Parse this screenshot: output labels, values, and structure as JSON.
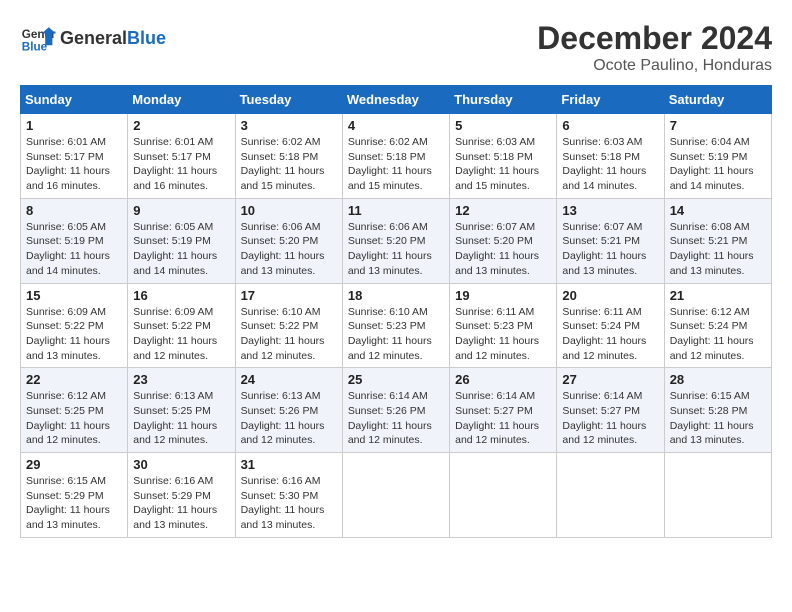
{
  "logo": {
    "text_general": "General",
    "text_blue": "Blue"
  },
  "title": "December 2024",
  "subtitle": "Ocote Paulino, Honduras",
  "days_of_week": [
    "Sunday",
    "Monday",
    "Tuesday",
    "Wednesday",
    "Thursday",
    "Friday",
    "Saturday"
  ],
  "weeks": [
    [
      {
        "day": "1",
        "info": "Sunrise: 6:01 AM\nSunset: 5:17 PM\nDaylight: 11 hours and 16 minutes."
      },
      {
        "day": "2",
        "info": "Sunrise: 6:01 AM\nSunset: 5:17 PM\nDaylight: 11 hours and 16 minutes."
      },
      {
        "day": "3",
        "info": "Sunrise: 6:02 AM\nSunset: 5:18 PM\nDaylight: 11 hours and 15 minutes."
      },
      {
        "day": "4",
        "info": "Sunrise: 6:02 AM\nSunset: 5:18 PM\nDaylight: 11 hours and 15 minutes."
      },
      {
        "day": "5",
        "info": "Sunrise: 6:03 AM\nSunset: 5:18 PM\nDaylight: 11 hours and 15 minutes."
      },
      {
        "day": "6",
        "info": "Sunrise: 6:03 AM\nSunset: 5:18 PM\nDaylight: 11 hours and 14 minutes."
      },
      {
        "day": "7",
        "info": "Sunrise: 6:04 AM\nSunset: 5:19 PM\nDaylight: 11 hours and 14 minutes."
      }
    ],
    [
      {
        "day": "8",
        "info": "Sunrise: 6:05 AM\nSunset: 5:19 PM\nDaylight: 11 hours and 14 minutes."
      },
      {
        "day": "9",
        "info": "Sunrise: 6:05 AM\nSunset: 5:19 PM\nDaylight: 11 hours and 14 minutes."
      },
      {
        "day": "10",
        "info": "Sunrise: 6:06 AM\nSunset: 5:20 PM\nDaylight: 11 hours and 13 minutes."
      },
      {
        "day": "11",
        "info": "Sunrise: 6:06 AM\nSunset: 5:20 PM\nDaylight: 11 hours and 13 minutes."
      },
      {
        "day": "12",
        "info": "Sunrise: 6:07 AM\nSunset: 5:20 PM\nDaylight: 11 hours and 13 minutes."
      },
      {
        "day": "13",
        "info": "Sunrise: 6:07 AM\nSunset: 5:21 PM\nDaylight: 11 hours and 13 minutes."
      },
      {
        "day": "14",
        "info": "Sunrise: 6:08 AM\nSunset: 5:21 PM\nDaylight: 11 hours and 13 minutes."
      }
    ],
    [
      {
        "day": "15",
        "info": "Sunrise: 6:09 AM\nSunset: 5:22 PM\nDaylight: 11 hours and 13 minutes."
      },
      {
        "day": "16",
        "info": "Sunrise: 6:09 AM\nSunset: 5:22 PM\nDaylight: 11 hours and 12 minutes."
      },
      {
        "day": "17",
        "info": "Sunrise: 6:10 AM\nSunset: 5:22 PM\nDaylight: 11 hours and 12 minutes."
      },
      {
        "day": "18",
        "info": "Sunrise: 6:10 AM\nSunset: 5:23 PM\nDaylight: 11 hours and 12 minutes."
      },
      {
        "day": "19",
        "info": "Sunrise: 6:11 AM\nSunset: 5:23 PM\nDaylight: 11 hours and 12 minutes."
      },
      {
        "day": "20",
        "info": "Sunrise: 6:11 AM\nSunset: 5:24 PM\nDaylight: 11 hours and 12 minutes."
      },
      {
        "day": "21",
        "info": "Sunrise: 6:12 AM\nSunset: 5:24 PM\nDaylight: 11 hours and 12 minutes."
      }
    ],
    [
      {
        "day": "22",
        "info": "Sunrise: 6:12 AM\nSunset: 5:25 PM\nDaylight: 11 hours and 12 minutes."
      },
      {
        "day": "23",
        "info": "Sunrise: 6:13 AM\nSunset: 5:25 PM\nDaylight: 11 hours and 12 minutes."
      },
      {
        "day": "24",
        "info": "Sunrise: 6:13 AM\nSunset: 5:26 PM\nDaylight: 11 hours and 12 minutes."
      },
      {
        "day": "25",
        "info": "Sunrise: 6:14 AM\nSunset: 5:26 PM\nDaylight: 11 hours and 12 minutes."
      },
      {
        "day": "26",
        "info": "Sunrise: 6:14 AM\nSunset: 5:27 PM\nDaylight: 11 hours and 12 minutes."
      },
      {
        "day": "27",
        "info": "Sunrise: 6:14 AM\nSunset: 5:27 PM\nDaylight: 11 hours and 12 minutes."
      },
      {
        "day": "28",
        "info": "Sunrise: 6:15 AM\nSunset: 5:28 PM\nDaylight: 11 hours and 13 minutes."
      }
    ],
    [
      {
        "day": "29",
        "info": "Sunrise: 6:15 AM\nSunset: 5:29 PM\nDaylight: 11 hours and 13 minutes."
      },
      {
        "day": "30",
        "info": "Sunrise: 6:16 AM\nSunset: 5:29 PM\nDaylight: 11 hours and 13 minutes."
      },
      {
        "day": "31",
        "info": "Sunrise: 6:16 AM\nSunset: 5:30 PM\nDaylight: 11 hours and 13 minutes."
      },
      {
        "day": "",
        "info": ""
      },
      {
        "day": "",
        "info": ""
      },
      {
        "day": "",
        "info": ""
      },
      {
        "day": "",
        "info": ""
      }
    ]
  ]
}
